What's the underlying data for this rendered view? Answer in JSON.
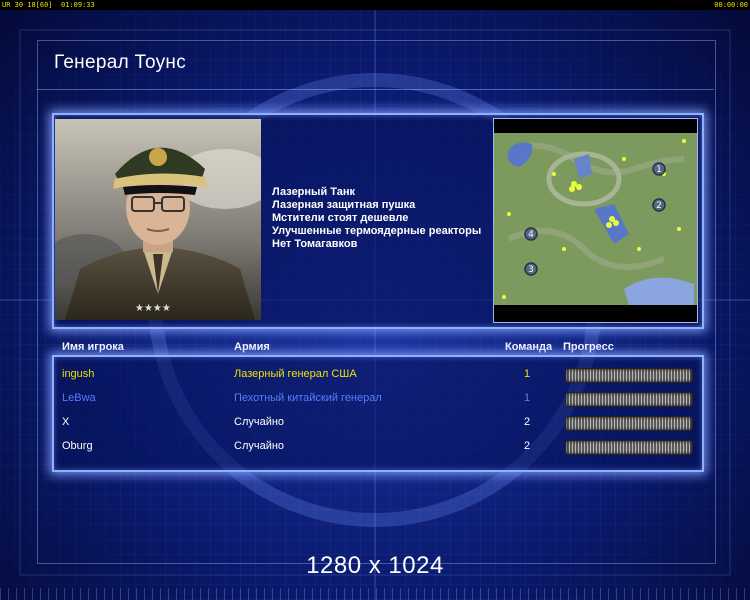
{
  "hud": {
    "left_text": "UR 30 18[60]  01:09:33",
    "right_text": "00:00:00"
  },
  "title": "Генерал Тоунс",
  "features": [
    "Лазерный Танк",
    "Лазерная защитная пушка",
    "Мстители стоят дешевле",
    "Улучшенные термоядерные реакторы",
    "Нет Томагавков"
  ],
  "minimap": {
    "start_markers": [
      "1",
      "2",
      "3",
      "4"
    ]
  },
  "columns": {
    "player": "Имя игрока",
    "army": "Армия",
    "team": "Команда",
    "progress": "Прогресс"
  },
  "players": [
    {
      "name": "ingush",
      "army": "Лазерный генерал США",
      "team": "1",
      "color": "#f0e000"
    },
    {
      "name": "LeBwa",
      "army": "Пехотный китайский генерал",
      "team": "1",
      "color": "#5a7cff"
    },
    {
      "name": "X",
      "army": "Случайно",
      "team": "2",
      "color": "#ffffff"
    },
    {
      "name": "Oburg",
      "army": "Случайно",
      "team": "2",
      "color": "#ffffff"
    }
  ],
  "resolution": "1280 x 1024"
}
